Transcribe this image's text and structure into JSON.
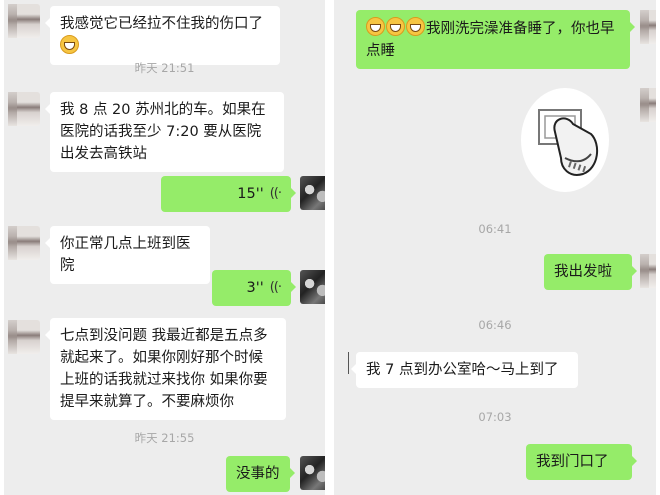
{
  "left": {
    "messages": [
      {
        "text": "我感觉它已经拉不住我的伤口了"
      },
      {
        "time": "昨天 21:51"
      },
      {
        "text": "我 8 点 20 苏州北的车。如果在医院的话我至少 7:20 要从医院出发去高铁站"
      },
      {
        "voice": "15''"
      },
      {
        "text": "你正常几点上班到医院"
      },
      {
        "voice": "3''"
      },
      {
        "text": "七点到没问题 我最近都是五点多就起来了。如果你刚好那个时候上班的话我就过来找你 如果你要提早来就算了。不要麻烦你"
      },
      {
        "time": "昨天 21:55"
      },
      {
        "text": "没事的"
      }
    ]
  },
  "right": {
    "messages": [
      {
        "text": "我刚洗完澡准备睡了，你也早点睡"
      },
      {
        "sticker": "cartoon-hand-sticker"
      },
      {
        "time": "06:41"
      },
      {
        "text": "我出发啦"
      },
      {
        "time": "06:46"
      },
      {
        "text": "我 7 点到办公室哈～马上到了"
      },
      {
        "time": "07:03"
      },
      {
        "text": "我到门口了"
      }
    ]
  },
  "colors": {
    "outgoing": "#95ec69",
    "incoming": "#ffffff",
    "background": "#ededed"
  }
}
